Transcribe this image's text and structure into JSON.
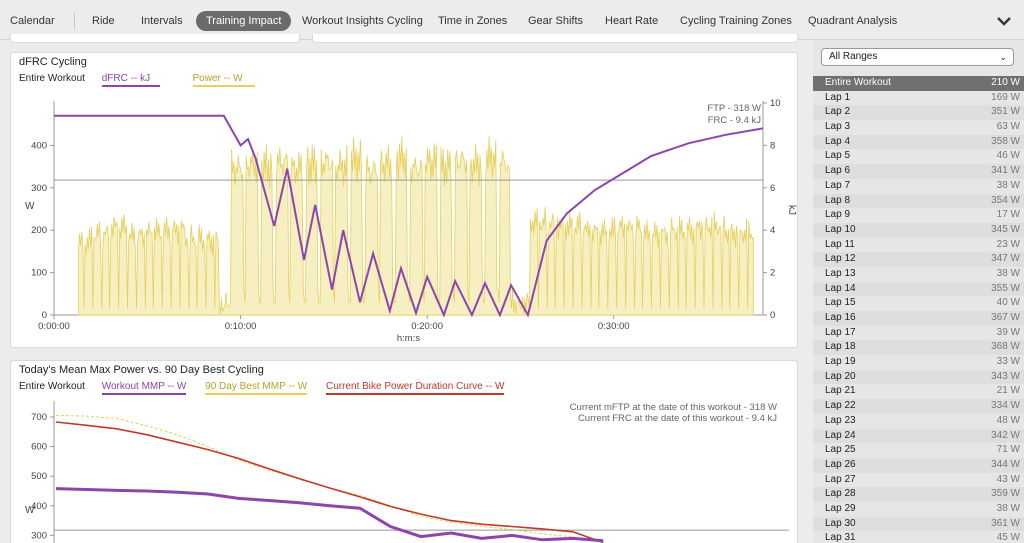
{
  "nav": {
    "tabs": [
      {
        "label": "Calendar"
      },
      {
        "label": "Ride"
      },
      {
        "label": "Intervals"
      },
      {
        "label": "Training Impact",
        "active": true
      },
      {
        "label": "Workout Insights Cycling"
      },
      {
        "label": "Time in Zones"
      },
      {
        "label": "Gear Shifts"
      },
      {
        "label": "Heart Rate"
      },
      {
        "label": "Cycling Training Zones"
      },
      {
        "label": "Quadrant Analysis"
      }
    ],
    "overflow_icon": "chevron-down-icon"
  },
  "panel1": {
    "title": "dFRC Cycling",
    "range_label": "Entire Workout",
    "legend": [
      {
        "label": "dFRC  -- kJ",
        "color": "#8e44ad"
      },
      {
        "label": "Power  -- W",
        "color": "#e6cf5a"
      }
    ],
    "ftp_label": "FTP - 318 W",
    "frc_label": "FRC - 9.4 kJ",
    "ylabel_left": "W",
    "ylabel_right": "kJ",
    "xlabel": "h:m:s"
  },
  "panel2": {
    "title": "Today's Mean Max Power vs. 90 Day Best Cycling",
    "range_label": "Entire Workout",
    "legend": [
      {
        "label": "Workout MMP  -- W",
        "color": "#8e44ad"
      },
      {
        "label": "90 Day Best MMP  -- W",
        "color": "#e6cf5a"
      },
      {
        "label": "Current Bike Power Duration Curve  -- W",
        "color": "#c0392b"
      }
    ],
    "mftp_label": "Current mFTP at the date of this workout - 318 W",
    "frc_label": "Current FRC at the date of this workout - 9.4 kJ",
    "ylabel_left": "W"
  },
  "sidebar": {
    "range_select": "All Ranges",
    "laps": [
      {
        "name": "Entire Workout",
        "value": "210 W",
        "selected": true
      },
      {
        "name": "Lap 1",
        "value": "169 W"
      },
      {
        "name": "Lap 2",
        "value": "351 W"
      },
      {
        "name": "Lap 3",
        "value": "63 W"
      },
      {
        "name": "Lap 4",
        "value": "358 W"
      },
      {
        "name": "Lap 5",
        "value": "46 W"
      },
      {
        "name": "Lap 6",
        "value": "341 W"
      },
      {
        "name": "Lap 7",
        "value": "38 W"
      },
      {
        "name": "Lap 8",
        "value": "354 W"
      },
      {
        "name": "Lap 9",
        "value": "17 W"
      },
      {
        "name": "Lap 10",
        "value": "345 W"
      },
      {
        "name": "Lap 11",
        "value": "23 W"
      },
      {
        "name": "Lap 12",
        "value": "347 W"
      },
      {
        "name": "Lap 13",
        "value": "38 W"
      },
      {
        "name": "Lap 14",
        "value": "355 W"
      },
      {
        "name": "Lap 15",
        "value": "40 W"
      },
      {
        "name": "Lap 16",
        "value": "367 W"
      },
      {
        "name": "Lap 17",
        "value": "39 W"
      },
      {
        "name": "Lap 18",
        "value": "368 W"
      },
      {
        "name": "Lap 19",
        "value": "33 W"
      },
      {
        "name": "Lap 20",
        "value": "343 W"
      },
      {
        "name": "Lap 21",
        "value": "21 W"
      },
      {
        "name": "Lap 22",
        "value": "334 W"
      },
      {
        "name": "Lap 23",
        "value": "48 W"
      },
      {
        "name": "Lap 24",
        "value": "342 W"
      },
      {
        "name": "Lap 25",
        "value": "71 W"
      },
      {
        "name": "Lap 26",
        "value": "344 W"
      },
      {
        "name": "Lap 27",
        "value": "43 W"
      },
      {
        "name": "Lap 28",
        "value": "359 W"
      },
      {
        "name": "Lap 29",
        "value": "38 W"
      },
      {
        "name": "Lap 30",
        "value": "361 W"
      },
      {
        "name": "Lap 31",
        "value": "45 W"
      }
    ]
  },
  "chart_data": [
    {
      "type": "line",
      "title": "dFRC Cycling",
      "xlabel": "h:m:s",
      "ylabel": "W",
      "y2label": "kJ",
      "x_ticks": [
        "0:00:00",
        "0:10:00",
        "0:20:00",
        "0:30:00"
      ],
      "xlim_min": [
        0,
        38
      ],
      "ylim": [
        0,
        500
      ],
      "yticks": [
        0,
        100,
        200,
        300,
        400
      ],
      "y2lim": [
        0,
        10
      ],
      "y2ticks": [
        0,
        2,
        4,
        6,
        8,
        10
      ],
      "ftp_line_w": 318,
      "series": [
        {
          "name": "dFRC",
          "unit": "kJ",
          "color": "#8e44ad",
          "axis": "right",
          "x_min": [
            0,
            9.1,
            10.0,
            10.4,
            10.8,
            11.8,
            12.5,
            13.4,
            14.0,
            14.9,
            15.5,
            16.4,
            17.1,
            18.0,
            18.6,
            19.4,
            20.0,
            20.9,
            21.5,
            22.4,
            23.1,
            23.9,
            24.5,
            25.4,
            26.4,
            27.5,
            29.0,
            30.5,
            32.0,
            34.0,
            36.0,
            38.0
          ],
          "values": [
            9.4,
            9.4,
            8.0,
            8.3,
            7.4,
            4.2,
            6.9,
            2.6,
            5.2,
            1.2,
            4.0,
            0.6,
            2.9,
            0.2,
            2.2,
            0.1,
            1.8,
            0.0,
            1.6,
            0.0,
            1.5,
            0.0,
            1.4,
            0.0,
            3.5,
            4.8,
            5.9,
            6.7,
            7.5,
            8.1,
            8.5,
            8.8
          ]
        },
        {
          "name": "Power",
          "unit": "W",
          "color": "#e6cf5a",
          "axis": "left",
          "x_min": [
            1.3,
            2,
            3,
            4,
            5,
            6,
            7,
            8,
            8.8,
            9.4,
            10.2,
            11.0,
            11.8,
            12.6,
            13.4,
            14.2,
            15.0,
            15.8,
            16.6,
            17.4,
            18.2,
            19.0,
            19.8,
            20.6,
            21.4,
            22.2,
            23.0,
            23.8,
            24.4,
            25.5,
            27,
            28.5,
            30,
            31.5,
            33,
            34.5,
            36,
            37.5
          ],
          "values": [
            170,
            190,
            205,
            185,
            195,
            200,
            180,
            175,
            30,
            345,
            355,
            350,
            360,
            345,
            355,
            360,
            350,
            365,
            340,
            355,
            370,
            345,
            360,
            350,
            365,
            355,
            370,
            360,
            30,
            220,
            210,
            195,
            205,
            190,
            200,
            210,
            195,
            175
          ]
        }
      ]
    },
    {
      "type": "line",
      "title": "Today's Mean Max Power vs. 90 Day Best Cycling",
      "ylabel": "W",
      "yticks": [
        300,
        400,
        500,
        600,
        700
      ],
      "reference_line_w": 318,
      "series": [
        {
          "name": "Workout MMP",
          "unit": "W",
          "color": "#8e44ad",
          "values": [
            458,
            455,
            452,
            450,
            446,
            440,
            425,
            418,
            410,
            400,
            392,
            330,
            296,
            308,
            290,
            300,
            285,
            290,
            282
          ]
        },
        {
          "name": "90 Day Best MMP",
          "unit": "W",
          "color": "#e6cf5a",
          "values": [
            705,
            703,
            695,
            670,
            640,
            600,
            555,
            520,
            490,
            460,
            435,
            400,
            365,
            345,
            330,
            320,
            305,
            295,
            280
          ]
        },
        {
          "name": "Current Bike Power Duration Curve",
          "unit": "W",
          "color": "#c0392b",
          "values": [
            683,
            672,
            660,
            640,
            615,
            590,
            560,
            525,
            492,
            460,
            430,
            398,
            372,
            350,
            338,
            330,
            322,
            312,
            276
          ]
        }
      ]
    }
  ]
}
